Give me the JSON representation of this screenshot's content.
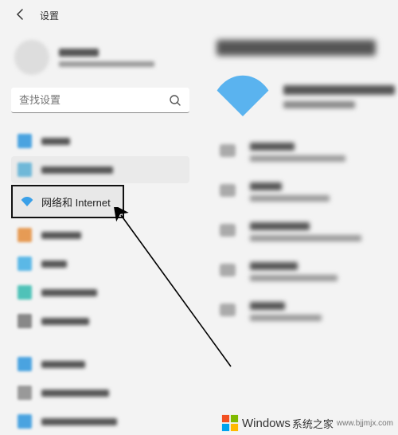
{
  "header": {
    "title": "设置"
  },
  "search": {
    "placeholder": "查找设置"
  },
  "sidebar": {
    "highlighted_item": {
      "label": "网络和 Internet"
    }
  },
  "watermark": {
    "brand": "Windows",
    "suffix": "系统之家",
    "url": "www.bjjmjx.com"
  }
}
